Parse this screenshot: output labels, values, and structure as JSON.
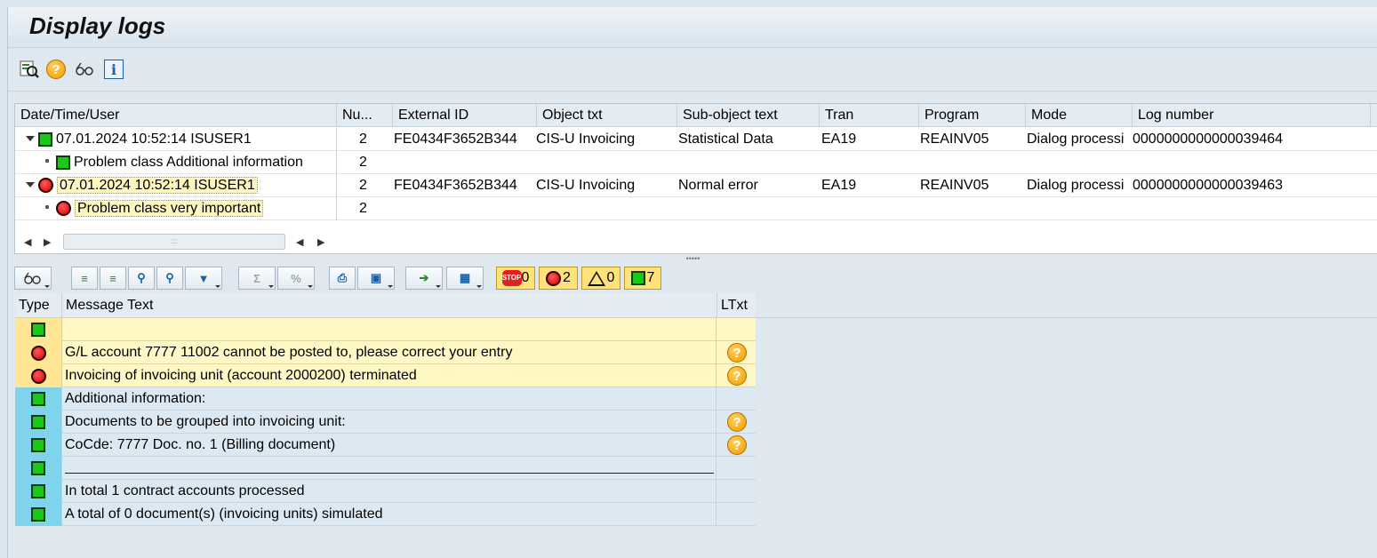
{
  "window": {
    "title": "Display logs"
  },
  "app_toolbar": {
    "icons": [
      "find-icon",
      "help-icon",
      "glasses-icon",
      "info-icon"
    ]
  },
  "log_table": {
    "headers": [
      "Date/Time/User",
      "Nu...",
      "External ID",
      "Object txt",
      "Sub-object text",
      "Tran",
      "Program",
      "Mode",
      "Log number"
    ],
    "rows": [
      {
        "tree": "07.01.2024  10:52:14  ISUSER1",
        "num": "2",
        "ext_id": "FE0434F3652B344",
        "object": "CIS-U Invoicing",
        "subobject": "Statistical Data",
        "tran": "EA19",
        "program": "REAINV05",
        "mode": "Dialog processi",
        "log_number": "0000000000000039464",
        "icon": "green-square"
      },
      {
        "tree": "Problem class Additional information",
        "num": "2",
        "icon": "green-square"
      },
      {
        "tree": "07.01.2024  10:52:14  ISUSER1",
        "num": "2",
        "ext_id": "FE0434F3652B344",
        "object": "CIS-U Invoicing",
        "subobject": "Normal error",
        "tran": "EA19",
        "program": "REAINV05",
        "mode": "Dialog processi",
        "log_number": "0000000000000039463",
        "icon": "red-circle"
      },
      {
        "tree": "Problem class very important",
        "num": "2",
        "icon": "red-circle"
      }
    ]
  },
  "msg_toolbar": {
    "stop_count": "0",
    "error_count": "2",
    "warning_count": "0",
    "success_count": "7"
  },
  "messages": {
    "headers": [
      "Type",
      "Message Text",
      "LTxt"
    ],
    "rows": [
      {
        "type": "green",
        "text": "",
        "style": "yel",
        "help": false
      },
      {
        "type": "red",
        "text": "G/L account 7777 11002 cannot be posted to, please correct your entry",
        "style": "yel",
        "help": true
      },
      {
        "type": "red",
        "text": "Invoicing of invoicing unit (account 2000200) terminated",
        "style": "yel",
        "help": true
      },
      {
        "type": "green",
        "text": "Additional information:",
        "style": "blu",
        "help": false
      },
      {
        "type": "green",
        "text": "Documents to be grouped into invoicing unit:",
        "style": "blu",
        "help": true
      },
      {
        "type": "green",
        "text": "CoCde: 7777 Doc. no. 1 (Billing document)",
        "style": "blu",
        "help": true
      },
      {
        "type": "green",
        "text": "",
        "style": "blu",
        "help": false,
        "underline": true
      },
      {
        "type": "green",
        "text": "In total 1 contract accounts processed",
        "style": "blu",
        "help": false
      },
      {
        "type": "green",
        "text": "A total of 0 document(s) (invoicing units) simulated",
        "style": "blu",
        "help": false
      }
    ]
  }
}
